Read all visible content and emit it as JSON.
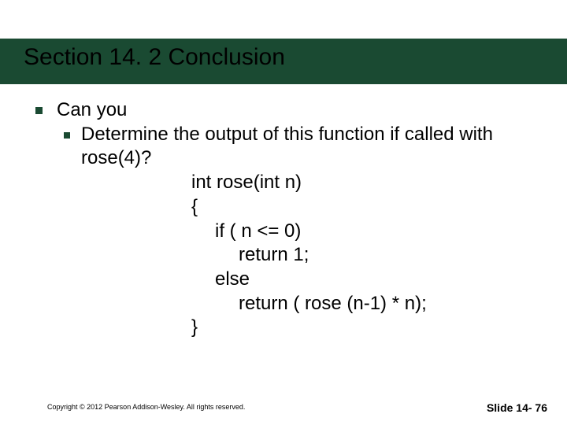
{
  "title": "Section 14. 2 Conclusion",
  "body": {
    "l1": "Can you",
    "l2": "Determine the output of this function if called with",
    "l3": "rose(4)?",
    "c1": "int rose(int n)",
    "c2": "{",
    "c3": "if ( n <= 0)",
    "c4": "return 1;",
    "c5": "else",
    "c6": "return ( rose (n-1) * n);",
    "c7": "}"
  },
  "footer": {
    "copyright": "Copyright © 2012 Pearson Addison-Wesley.  All rights reserved.",
    "slide": "Slide 14- 76"
  }
}
